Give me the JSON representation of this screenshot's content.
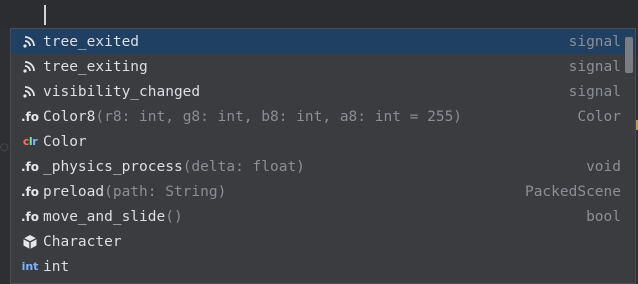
{
  "items": [
    {
      "icon": "signal-icon",
      "name": "tree_exited",
      "signature": "",
      "type": "signal",
      "selected": true
    },
    {
      "icon": "signal-icon",
      "name": "tree_exiting",
      "signature": "",
      "type": "signal"
    },
    {
      "icon": "signal-icon",
      "name": "visibility_changed",
      "signature": "",
      "type": "signal"
    },
    {
      "icon": "function-icon",
      "name": "Color8",
      "signature": "(r8: int, g8: int, b8: int, a8: int = 255)",
      "type": "Color"
    },
    {
      "icon": "color-class-icon",
      "name": "Color",
      "signature": "",
      "type": ""
    },
    {
      "icon": "function-icon",
      "name": "_physics_process",
      "signature": "(delta: float)",
      "type": "void"
    },
    {
      "icon": "function-icon",
      "name": "preload",
      "signature": "(path: String)",
      "type": "PackedScene"
    },
    {
      "icon": "function-icon",
      "name": "move_and_slide",
      "signature": "()",
      "type": "bool"
    },
    {
      "icon": "class-icon",
      "name": "Character",
      "signature": "",
      "type": ""
    },
    {
      "icon": "int-type-icon",
      "name": "int",
      "signature": "",
      "type": ""
    }
  ],
  "icon_text": {
    "function": ".fo",
    "color_class": "clr",
    "int_type": "int"
  },
  "colors": {
    "selection": "#1f3f63",
    "popup_bg": "#3a3c40",
    "signature_text": "#8b8e94"
  }
}
